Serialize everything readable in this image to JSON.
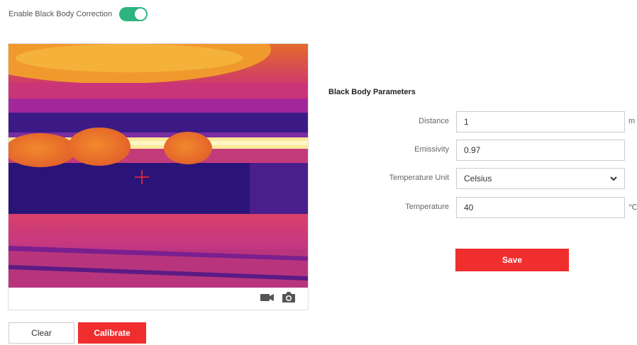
{
  "toggle": {
    "label": "Enable Black Body Correction",
    "enabled": true,
    "color": "#2db47e"
  },
  "video": {
    "icons": [
      "video-camera-icon",
      "camera-snapshot-icon"
    ],
    "crosshair_color": "#ff2a2a"
  },
  "actions": {
    "clear_label": "Clear",
    "calibrate_label": "Calibrate"
  },
  "params": {
    "title": "Black Body Parameters",
    "distance": {
      "label": "Distance",
      "value": "1",
      "unit": "m"
    },
    "emissivity": {
      "label": "Emissivity",
      "value": "0.97"
    },
    "temperature_unit": {
      "label": "Temperature Unit",
      "value": "Celsius"
    },
    "temperature": {
      "label": "Temperature",
      "value": "40",
      "unit": "℃"
    },
    "save_label": "Save"
  },
  "colors": {
    "accent": "#f02e2e",
    "toggle_on": "#2db47e"
  }
}
